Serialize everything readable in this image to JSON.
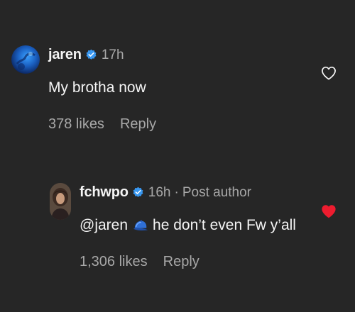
{
  "comments": [
    {
      "username": "jaren",
      "verified": true,
      "time": "17h",
      "text": "My brotha now",
      "likes": "378 likes",
      "reply_label": "Reply",
      "liked": false,
      "avatar_icon": "blue-globe-avatar"
    },
    {
      "username": "fchwpo",
      "verified": true,
      "time": "16h",
      "separator": "·",
      "post_author_label": "Post author",
      "mention": "@jaren",
      "emoji_icon": "blue-cap-emoji",
      "text": "he don’t even Fw y’all",
      "likes": "1,306 likes",
      "reply_label": "Reply",
      "liked": true,
      "avatar_icon": "person-photo-avatar"
    }
  ],
  "colors": {
    "background": "#262626",
    "primary_text": "#f5f5f5",
    "secondary_text": "#a8a8a8",
    "verified_badge": "#3897f0",
    "liked_heart": "#ed1c2f"
  }
}
